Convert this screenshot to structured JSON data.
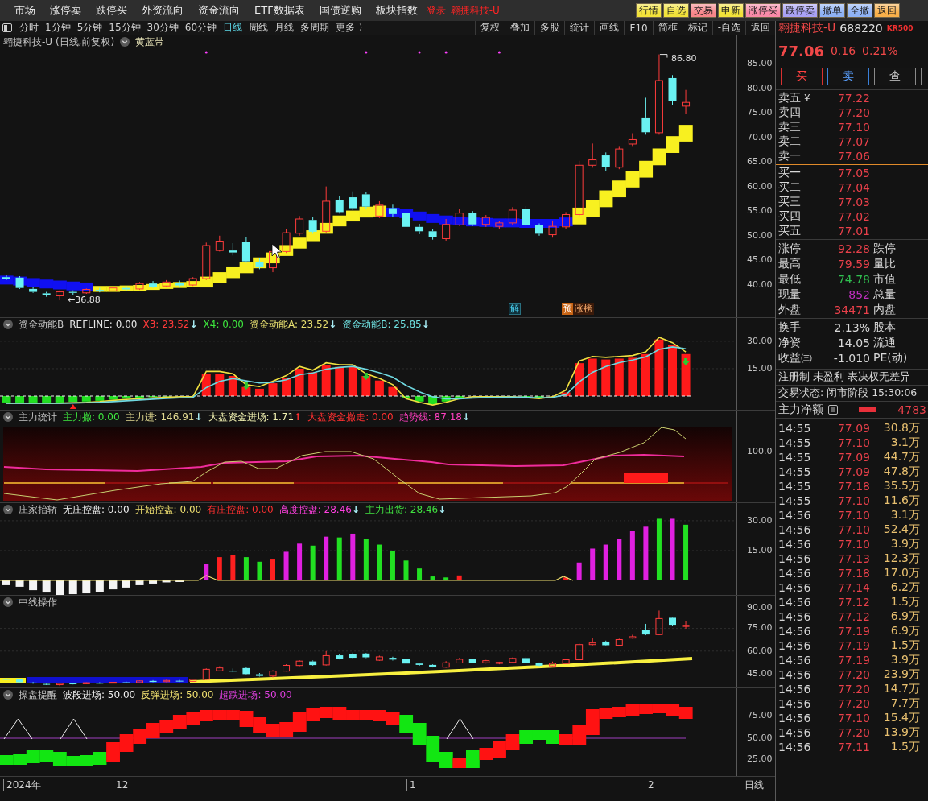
{
  "menu_bar": {
    "items": [
      "市场",
      "涨停卖",
      "跌停买",
      "外资流向",
      "资金流向",
      "ETF数据表",
      "国债逆购",
      "板块指数"
    ],
    "login": "登录",
    "stock": "翱捷科技-U",
    "quick_buttons": [
      {
        "label": "行情",
        "color": "#f2e23a"
      },
      {
        "label": "自选",
        "color": "#f2e23a"
      },
      {
        "label": "交易",
        "color": "#f7868a"
      },
      {
        "label": "申新",
        "color": "#f2e23a"
      },
      {
        "label": "涨停买",
        "color": "#f98aa8"
      },
      {
        "label": "跌停卖",
        "color": "#a9a2f5"
      },
      {
        "label": "撤单",
        "color": "#8fb2f5"
      },
      {
        "label": "全撤",
        "color": "#8fb2f5"
      },
      {
        "label": "返回",
        "color": "#f9b04a"
      }
    ]
  },
  "toolbar": {
    "periods": [
      {
        "label": "分时",
        "selected": false
      },
      {
        "label": "1分钟",
        "selected": false
      },
      {
        "label": "5分钟",
        "selected": false
      },
      {
        "label": "15分钟",
        "selected": false
      },
      {
        "label": "30分钟",
        "selected": false
      },
      {
        "label": "60分钟",
        "selected": false
      },
      {
        "label": "日线",
        "selected": true
      },
      {
        "label": "周线",
        "selected": false
      },
      {
        "label": "月线",
        "selected": false
      },
      {
        "label": "多周期",
        "selected": false
      }
    ],
    "more": "更多 〉",
    "tools": [
      "复权",
      "叠加",
      "多股",
      "统计",
      "画线",
      "F10",
      "简框",
      "标记",
      "-自选",
      "返回"
    ]
  },
  "price_chart": {
    "title": "翱捷科技-U (日线,前复权)",
    "indicator": "黄蓝带",
    "axis_labels": [
      "85.00",
      "80.00",
      "75.00",
      "70.00",
      "65.00",
      "60.00",
      "55.00",
      "50.00",
      "45.00",
      "40.00"
    ],
    "high_label": "86.80",
    "low_label": "←36.88",
    "tags": [
      {
        "kind": "outlined",
        "text": "解"
      },
      {
        "kind": "filled",
        "text": "预"
      },
      {
        "kind": "plain",
        "text": "涨榜"
      }
    ]
  },
  "indicators": [
    {
      "kind": "momentum",
      "title": "资金动能B",
      "series": [
        {
          "label": "REFLINE: 0.00",
          "color": "#e6e6e6"
        },
        {
          "label": "X3: 23.52",
          "color": "#ff3b3b",
          "arrow": "↓",
          "rising": false
        },
        {
          "label": "X4: 0.00",
          "color": "#3ee63e"
        },
        {
          "label": "资金动能A: 23.52",
          "color": "#e8e070",
          "arrow": "↓",
          "rising": false
        },
        {
          "label": "资金动能B: 25.85",
          "color": "#6fe0e0",
          "arrow": "↓",
          "rising": false
        }
      ],
      "axis_labels": [
        "30.00",
        "15.00"
      ]
    },
    {
      "kind": "flow",
      "title": "主力统计",
      "series": [
        {
          "label": "主力撤: 0.00",
          "color": "#3ee63e"
        },
        {
          "label": "主力进: 146.91",
          "color": "#e0d890",
          "arrow": "↓",
          "rising": false
        },
        {
          "label": "大盘资金进场: 1.71",
          "color": "#f0f0b0",
          "arrow": "↑",
          "rising": true
        },
        {
          "label": "大盘资金撤走: 0.00",
          "color": "#ff3030"
        },
        {
          "label": "趋势线: 87.18",
          "color": "#ff40c0",
          "arrow": "↓",
          "rising": false
        }
      ],
      "axis_labels": [
        "100.0"
      ]
    },
    {
      "kind": "control",
      "title": "庄家抬轿",
      "series": [
        {
          "label": "无庄控盘: 0.00",
          "color": "#f0f0f0"
        },
        {
          "label": "开始控盘: 0.00",
          "color": "#f0e070"
        },
        {
          "label": "有庄控盘: 0.00",
          "color": "#ff3030"
        },
        {
          "label": "高度控盘: 28.46",
          "color": "#ff40e0",
          "arrow": "↓",
          "rising": false
        },
        {
          "label": "主力出货: 28.46",
          "color": "#40e040",
          "arrow": "↓",
          "rising": false
        }
      ],
      "axis_labels": [
        "30.00",
        "15.00"
      ]
    },
    {
      "kind": "candles",
      "title": "中线操作",
      "axis_labels": [
        "90.00",
        "75.00",
        "60.00",
        "45.00"
      ]
    },
    {
      "kind": "ladder",
      "title": "操盘提醒",
      "series": [
        {
          "label": "波段进场: 50.00",
          "color": "#f0f0f0"
        },
        {
          "label": "反弹进场: 50.00",
          "color": "#f0e070"
        },
        {
          "label": "超跌进场: 50.00",
          "color": "#e040e0"
        }
      ],
      "axis_labels": [
        "75.00",
        "50.00",
        "25.00"
      ]
    }
  ],
  "date_axis": {
    "labels": [
      "2024年",
      "12",
      "1",
      "2"
    ],
    "period": "日线"
  },
  "quote": {
    "name": "翱捷科技-U",
    "code": "688220",
    "badge": "KR500",
    "price": "77.06",
    "change": "0.16",
    "change_pct": "0.21%",
    "actions": [
      {
        "kind": "buy",
        "label": "买"
      },
      {
        "kind": "sell",
        "label": "卖"
      },
      {
        "kind": "query",
        "label": "查"
      },
      {
        "kind": "cut"
      }
    ],
    "asks": [
      {
        "label": "卖五",
        "mark": "¥",
        "price": "77.22"
      },
      {
        "label": "卖四",
        "price": "77.20"
      },
      {
        "label": "卖三",
        "price": "77.10"
      },
      {
        "label": "卖二",
        "price": "77.07"
      },
      {
        "label": "卖一",
        "price": "77.06"
      }
    ],
    "bids": [
      {
        "label": "买一",
        "price": "77.05"
      },
      {
        "label": "买二",
        "price": "77.04"
      },
      {
        "label": "买三",
        "price": "77.03"
      },
      {
        "label": "买四",
        "price": "77.02"
      },
      {
        "label": "买五",
        "price": "77.01"
      }
    ],
    "stats": [
      {
        "label": "涨停",
        "value": "92.28",
        "color": "#e8404a",
        "label_2": "跌停"
      },
      {
        "label": "最高",
        "value": "79.59",
        "color": "#e8404a",
        "label_2": "量比"
      },
      {
        "label": "最低",
        "value": "74.78",
        "color": "#30c050",
        "label_2": "市值"
      },
      {
        "label": "现量",
        "value": "852",
        "color": "#c030c0",
        "label_2": "总量"
      },
      {
        "label": "外盘",
        "value": "34471",
        "color": "#e8404a",
        "label_2": "内盘"
      }
    ],
    "fundamentals": [
      {
        "label": "换手",
        "value": "2.13%",
        "label_2": "股本"
      },
      {
        "label": "净资",
        "value": "14.05",
        "label_2": "流通"
      },
      {
        "label": "收益㈢",
        "value": "-1.010",
        "label_2": "PE(动)"
      }
    ],
    "notice": "注册制 未盈利 表决权无差异",
    "status": "交易状态: 闭市阶段 15:30:06",
    "net_flow": {
      "label": "主力净额",
      "value": "4783"
    },
    "trades": [
      {
        "time": "14:55",
        "price": "77.09",
        "volume": "30.8万"
      },
      {
        "time": "14:55",
        "price": "77.10",
        "volume": "3.1万"
      },
      {
        "time": "14:55",
        "price": "77.09",
        "volume": "44.7万"
      },
      {
        "time": "14:55",
        "price": "77.09",
        "volume": "47.8万"
      },
      {
        "time": "14:55",
        "price": "77.18",
        "volume": "35.5万"
      },
      {
        "time": "14:55",
        "price": "77.10",
        "volume": "11.6万"
      },
      {
        "time": "14:56",
        "price": "77.10",
        "volume": "3.1万"
      },
      {
        "time": "14:56",
        "price": "77.10",
        "volume": "52.4万"
      },
      {
        "time": "14:56",
        "price": "77.10",
        "volume": "3.9万"
      },
      {
        "time": "14:56",
        "price": "77.13",
        "volume": "12.3万"
      },
      {
        "time": "14:56",
        "price": "77.18",
        "volume": "17.0万"
      },
      {
        "time": "14:56",
        "price": "77.14",
        "volume": "6.2万"
      },
      {
        "time": "14:56",
        "price": "77.12",
        "volume": "1.5万"
      },
      {
        "time": "14:56",
        "price": "77.12",
        "volume": "6.9万"
      },
      {
        "time": "14:56",
        "price": "77.19",
        "volume": "6.9万"
      },
      {
        "time": "14:56",
        "price": "77.19",
        "volume": "1.5万"
      },
      {
        "time": "14:56",
        "price": "77.19",
        "volume": "3.9万"
      },
      {
        "time": "14:56",
        "price": "77.20",
        "volume": "23.9万"
      },
      {
        "time": "14:56",
        "price": "77.20",
        "volume": "14.7万"
      },
      {
        "time": "14:56",
        "price": "77.20",
        "volume": "7.7万"
      },
      {
        "time": "14:56",
        "price": "77.10",
        "volume": "15.4万"
      },
      {
        "time": "14:56",
        "price": "77.20",
        "volume": "13.9万"
      },
      {
        "time": "14:56",
        "price": "77.11",
        "volume": "1.5万"
      }
    ]
  }
}
